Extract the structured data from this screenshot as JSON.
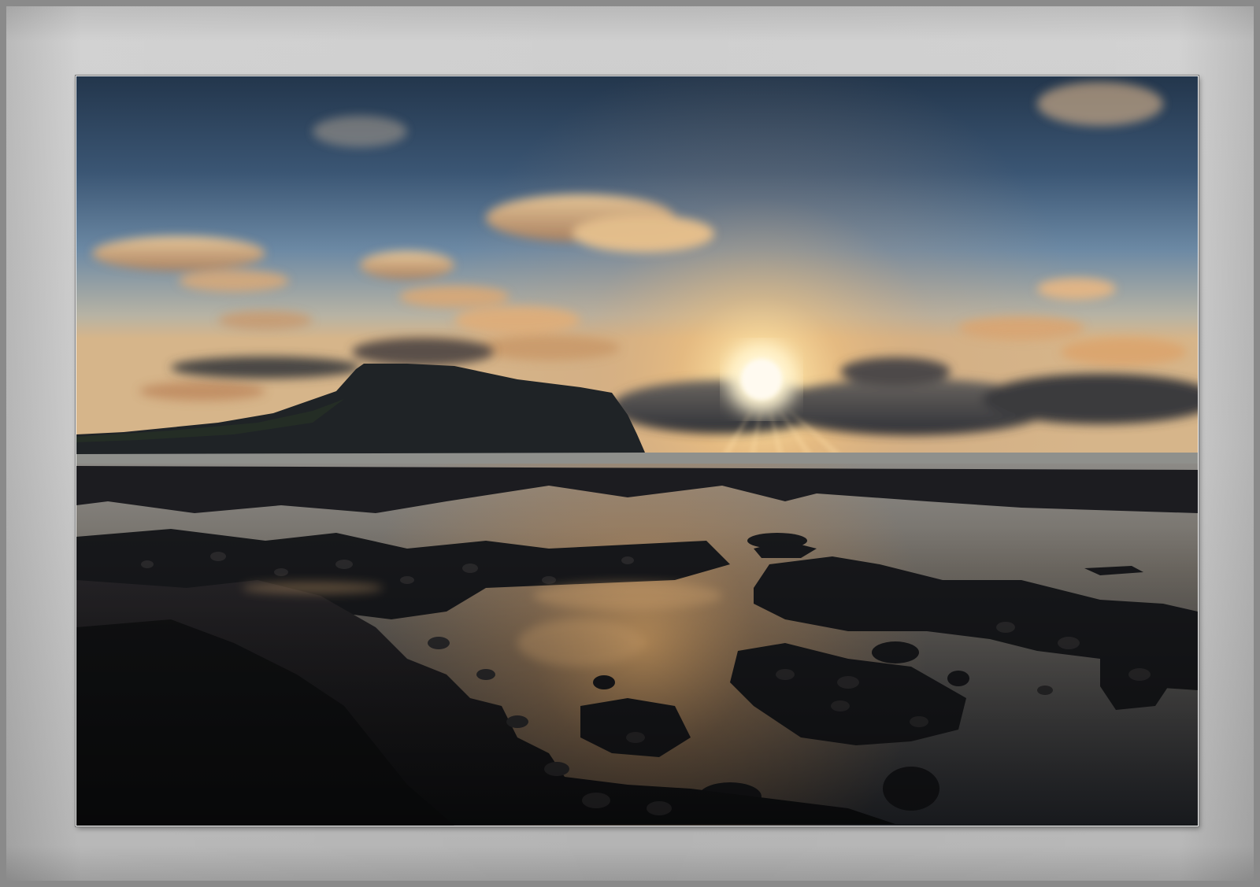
{
  "image": {
    "subject": "coastal-sunset-seascape",
    "colors": {
      "frame": "#c4c4c4",
      "sky_top": "#2a3c52",
      "sky_mid": "#5b7a98",
      "horizon_glow": "#f3c57a",
      "sun": "#fff6d8",
      "rock": "#17181b",
      "water_reflection": "#c79a63"
    }
  }
}
